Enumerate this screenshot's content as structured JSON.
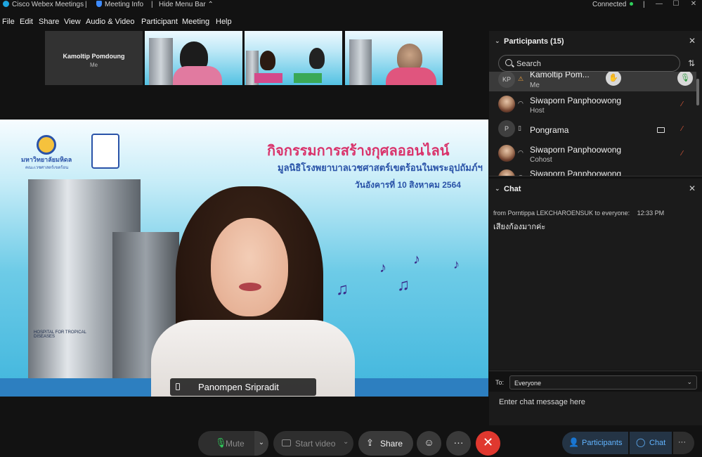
{
  "titlebar": {
    "app_name": "Cisco Webex Meetings",
    "meeting_info": "Meeting Info",
    "hide_menu": "Hide Menu Bar",
    "hide_menu_icon": "chevron-up-icon",
    "status": "Connected",
    "separator": "|"
  },
  "menu": [
    "File",
    "Edit",
    "Share",
    "View",
    "Audio & Video",
    "Participant",
    "Meeting",
    "Help"
  ],
  "thumbnails": {
    "me_name": "Kamoltip Pomdoung",
    "me_sub": "Me"
  },
  "main_video": {
    "title_th": "กิจกรรมการสร้างกุศลออนไลน์",
    "subtitle_th": "มูลนิธิโรงพยาบาลเวชศาสตร์เขตร้อนในพระอุปถัมภ์ฯ",
    "date_th": "วันอังคารที่ 10 สิงหาคม 2564",
    "university_th": "มหาวิทยาลัยมหิดล",
    "faculty_th": "คณะเวชศาสตร์เขตร้อน",
    "hospital_text": "HOSPITAL FOR TROPICAL DISEASES",
    "speaker_name": "Panompen Sripradit"
  },
  "participants": {
    "title": "Participants (15)",
    "search_placeholder": "Search",
    "list": [
      {
        "initials": "KP",
        "name": "Kamoltip Pom...",
        "role": "Me",
        "avatar": "initials"
      },
      {
        "initials": "",
        "name": "Siwaporn Panphoowong",
        "role": "Host",
        "avatar": "photo"
      },
      {
        "initials": "P",
        "name": "Pongrama",
        "role": "",
        "avatar": "initials"
      },
      {
        "initials": "",
        "name": "Siwaporn Panphoowong",
        "role": "Cohost",
        "avatar": "photo"
      },
      {
        "initials": "",
        "name": "Siwaporn Panphoowong",
        "role": "",
        "avatar": "photo"
      }
    ]
  },
  "chat": {
    "title": "Chat",
    "message_meta": "from Porntippa LEKCHAROENSUK to everyone:",
    "message_time": "12:33 PM",
    "message_text": "เสียงก้องมากค่ะ",
    "to_label": "To:",
    "to_value": "Everyone",
    "input_placeholder": "Enter chat message here"
  },
  "controls": {
    "mute": "Mute",
    "start_video": "Start video",
    "share": "Share",
    "participants": "Participants",
    "chat": "Chat",
    "more": "···",
    "end_icon": "✕"
  },
  "colors": {
    "end_call": "#e0382f",
    "connected": "#2fd05c",
    "accent_blue": "#62b4ff",
    "muted_red": "#e05a3a"
  }
}
